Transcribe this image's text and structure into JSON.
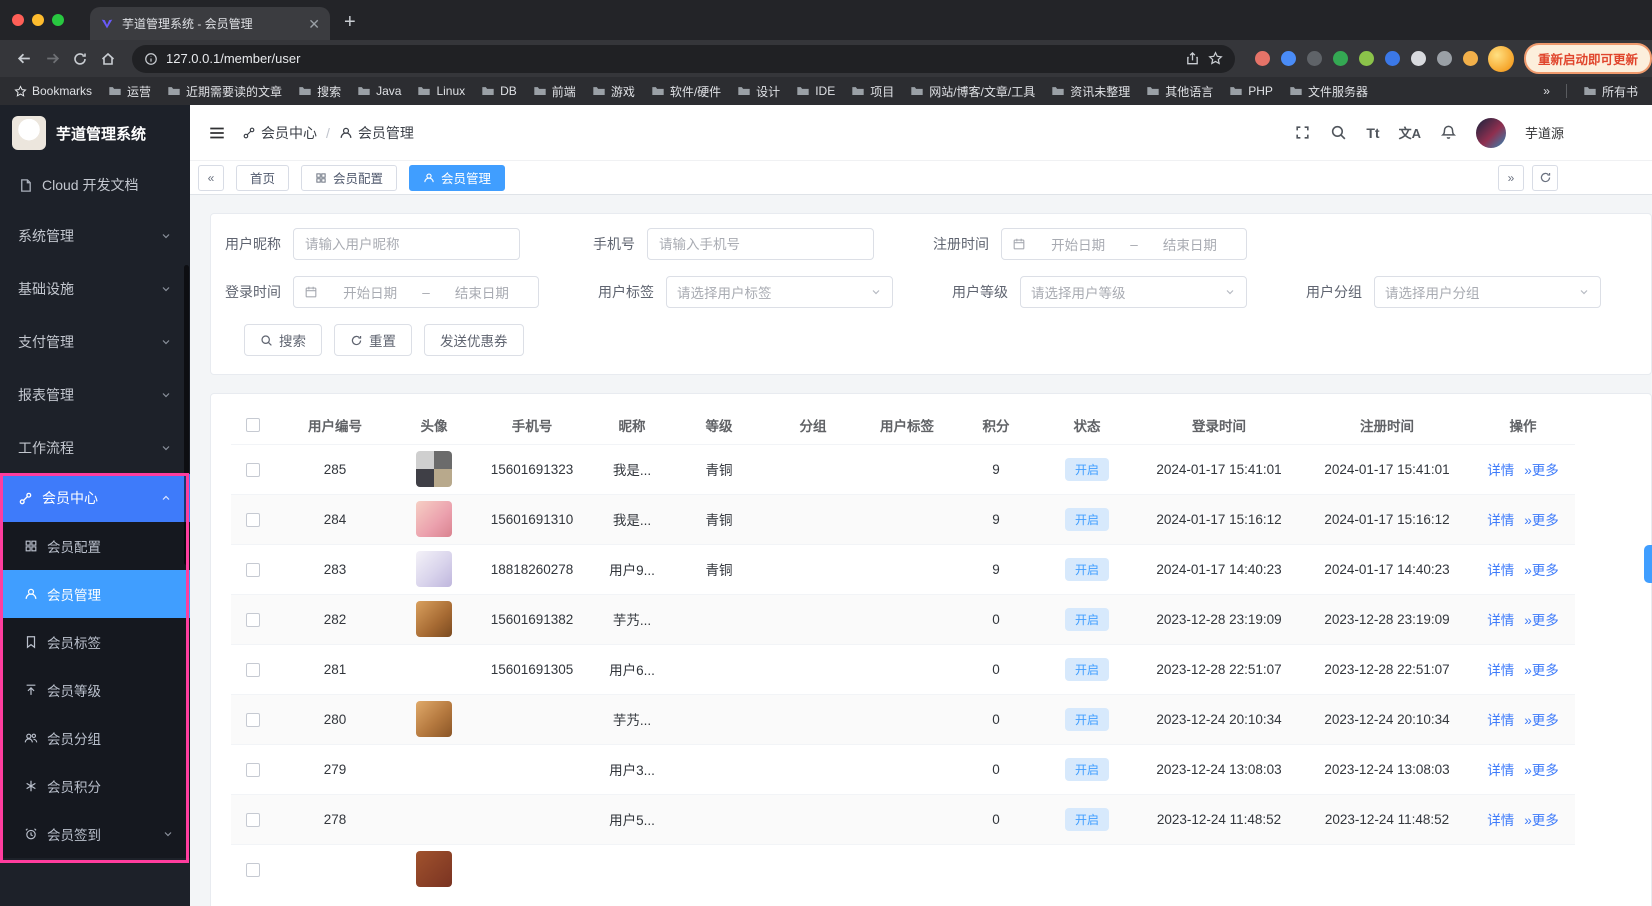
{
  "colors": {
    "primary": "#409eff",
    "sidebar_active": "#3e7bfa",
    "highlight_annotation": "#ff3d9e",
    "status_pill_bg": "#d7e9fc"
  },
  "browser": {
    "tab_title": "芋道管理系统 - 会员管理",
    "url": "127.0.0.1/member/user",
    "update_button_label": "重新启动即可更新",
    "extension_icon_colors": [
      "#e57368",
      "#4a8cf7",
      "#5f6368",
      "#34a853",
      "#8bc34a",
      "#3b78e7",
      "#d8dade",
      "#9aa0a6",
      "#f2b04a"
    ],
    "bookmarks_bar": {
      "bookmarks_label": "Bookmarks",
      "folders": [
        "运营",
        "近期需要读的文章",
        "搜索",
        "Java",
        "Linux",
        "DB",
        "前端",
        "游戏",
        "软件/硬件",
        "设计",
        "IDE",
        "项目",
        "网站/博客/文章/工具",
        "资讯未整理",
        "其他语言",
        "PHP",
        "文件服务器"
      ],
      "overflow_chevron": "»",
      "all_bookmarks_label": "所有书"
    }
  },
  "sidebar": {
    "app_title": "芋道管理系统",
    "doc_link_label": "Cloud 开发文档",
    "groups": [
      {
        "label": "系统管理"
      },
      {
        "label": "基础设施"
      },
      {
        "label": "支付管理"
      },
      {
        "label": "报表管理"
      },
      {
        "label": "工作流程"
      }
    ],
    "member_center": {
      "label": "会员中心",
      "children": [
        {
          "label": "会员配置"
        },
        {
          "label": "会员管理"
        },
        {
          "label": "会员标签"
        },
        {
          "label": "会员等级"
        },
        {
          "label": "会员分组"
        },
        {
          "label": "会员积分"
        },
        {
          "label": "会员签到"
        }
      ],
      "active_child": "会员管理"
    }
  },
  "header": {
    "breadcrumb": [
      {
        "label": "会员中心"
      },
      {
        "label": "会员管理"
      }
    ],
    "font_size_button": "Tt",
    "locale_button": "文A",
    "user_name": "芋道源"
  },
  "page_tabs": [
    {
      "label": "首页"
    },
    {
      "label": "会员配置"
    },
    {
      "label": "会员管理",
      "active": true
    }
  ],
  "filter": {
    "fields": {
      "nickname": {
        "label": "用户昵称",
        "placeholder": "请输入用户昵称"
      },
      "mobile": {
        "label": "手机号",
        "placeholder": "请输入手机号"
      },
      "register_time": {
        "label": "注册时间",
        "start": "开始日期",
        "separator": "–",
        "end": "结束日期"
      },
      "login_time": {
        "label": "登录时间",
        "start": "开始日期",
        "separator": "–",
        "end": "结束日期"
      },
      "tag": {
        "label": "用户标签",
        "placeholder": "请选择用户标签"
      },
      "level": {
        "label": "用户等级",
        "placeholder": "请选择用户等级"
      },
      "group": {
        "label": "用户分组",
        "placeholder": "请选择用户分组"
      }
    },
    "buttons": {
      "search": "搜索",
      "reset": "重置",
      "coupon": "发送优惠券"
    }
  },
  "table": {
    "columns": [
      "用户编号",
      "头像",
      "手机号",
      "昵称",
      "等级",
      "分组",
      "用户标签",
      "积分",
      "状态",
      "登录时间",
      "注册时间",
      "操作"
    ],
    "action_detail": "详情",
    "action_more": "更多",
    "partial_row_avatar": "maroon",
    "rows": [
      {
        "id": "285",
        "avatar": "mosaic",
        "mobile": "15601691323",
        "nickname": "我是...",
        "level": "青铜",
        "group": "",
        "tags": "",
        "points": "9",
        "status": "开启",
        "login_time": "2024-01-17 15:41:01",
        "register_time": "2024-01-17 15:41:01"
      },
      {
        "id": "284",
        "avatar": "pink",
        "mobile": "15601691310",
        "nickname": "我是...",
        "level": "青铜",
        "group": "",
        "tags": "",
        "points": "9",
        "status": "开启",
        "login_time": "2024-01-17 15:16:12",
        "register_time": "2024-01-17 15:16:12"
      },
      {
        "id": "283",
        "avatar": "lavender",
        "mobile": "18818260278",
        "nickname": "用户9...",
        "level": "青铜",
        "group": "",
        "tags": "",
        "points": "9",
        "status": "开启",
        "login_time": "2024-01-17 14:40:23",
        "register_time": "2024-01-17 14:40:23"
      },
      {
        "id": "282",
        "avatar": "cat",
        "mobile": "15601691382",
        "nickname": "芋艿...",
        "level": "",
        "group": "",
        "tags": "",
        "points": "0",
        "status": "开启",
        "login_time": "2023-12-28 23:19:09",
        "register_time": "2023-12-28 23:19:09"
      },
      {
        "id": "281",
        "avatar": "",
        "mobile": "15601691305",
        "nickname": "用户6...",
        "level": "",
        "group": "",
        "tags": "",
        "points": "0",
        "status": "开启",
        "login_time": "2023-12-28 22:51:07",
        "register_time": "2023-12-28 22:51:07"
      },
      {
        "id": "280",
        "avatar": "cat2",
        "mobile": "",
        "nickname": "芋艿...",
        "level": "",
        "group": "",
        "tags": "",
        "points": "0",
        "status": "开启",
        "login_time": "2023-12-24 20:10:34",
        "register_time": "2023-12-24 20:10:34"
      },
      {
        "id": "279",
        "avatar": "",
        "mobile": "",
        "nickname": "用户3...",
        "level": "",
        "group": "",
        "tags": "",
        "points": "0",
        "status": "开启",
        "login_time": "2023-12-24 13:08:03",
        "register_time": "2023-12-24 13:08:03"
      },
      {
        "id": "278",
        "avatar": "",
        "mobile": "",
        "nickname": "用户5...",
        "level": "",
        "group": "",
        "tags": "",
        "points": "0",
        "status": "开启",
        "login_time": "2023-12-24 11:48:52",
        "register_time": "2023-12-24 11:48:52"
      }
    ]
  }
}
